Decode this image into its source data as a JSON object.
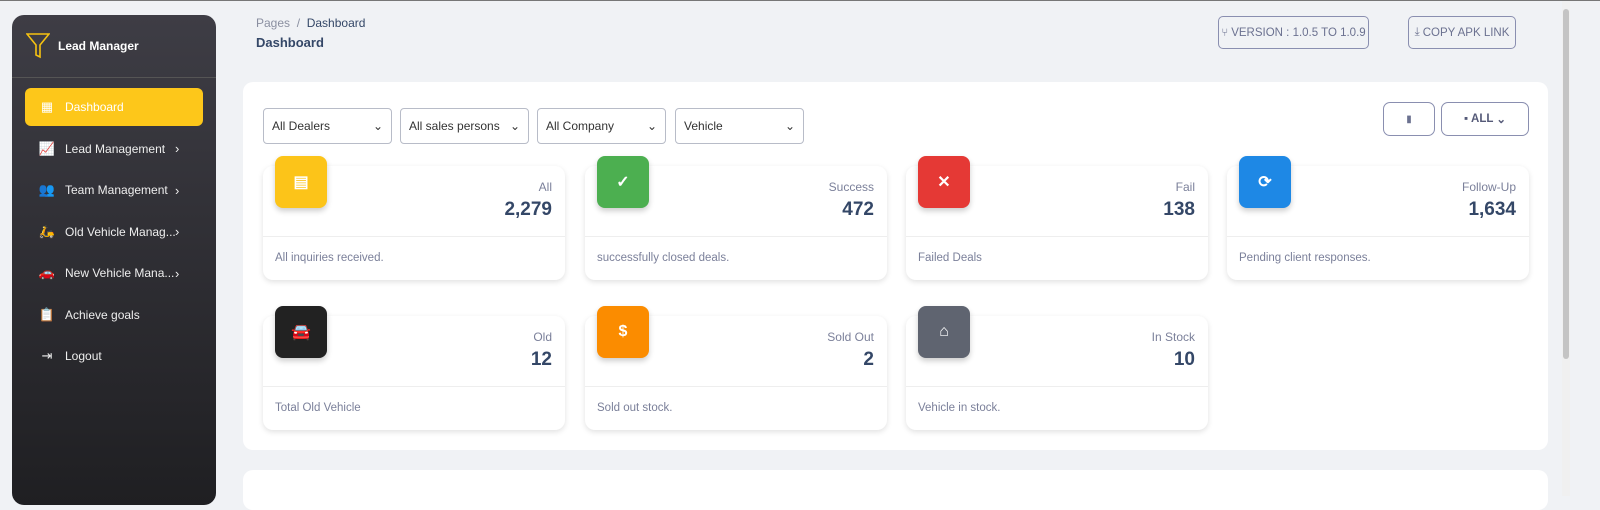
{
  "sidebar": {
    "brand": "Lead Manager",
    "items": [
      {
        "label": "Dashboard",
        "icon": "grid-icon",
        "active": true
      },
      {
        "label": "Lead Management",
        "icon": "chart-line-icon",
        "submenu": true
      },
      {
        "label": "Team Management",
        "icon": "users-icon",
        "submenu": true
      },
      {
        "label": "Old Vehicle Manag...",
        "icon": "scooter-icon",
        "submenu": true
      },
      {
        "label": "New Vehicle Mana...",
        "icon": "car-icon",
        "submenu": true
      },
      {
        "label": "Achieve goals",
        "icon": "clipboard-icon"
      },
      {
        "label": "Logout",
        "icon": "logout-icon"
      }
    ]
  },
  "header": {
    "breadcrumb_root": "Pages",
    "breadcrumb_sep": "/",
    "breadcrumb_current": "Dashboard",
    "title": "Dashboard",
    "version_label": "VERSION : 1.0.5 TO 1.0.9",
    "apk_label": "COPY APK LINK"
  },
  "filters": {
    "dealers": "All Dealers",
    "sales": "All sales persons",
    "company": "All Company",
    "vehicle": "Vehicle",
    "range": "ALL"
  },
  "stats": [
    {
      "label": "All",
      "value": "2,279",
      "desc": "All inquiries received.",
      "color": "#fcc419",
      "icon": "clipboard-icon"
    },
    {
      "label": "Success",
      "value": "472",
      "desc": "successfully closed deals.",
      "color": "#4caf50",
      "icon": "check-circle-icon"
    },
    {
      "label": "Fail",
      "value": "138",
      "desc": "Failed Deals",
      "color": "#e53935",
      "icon": "x-circle-icon"
    },
    {
      "label": "Follow-Up",
      "value": "1,634",
      "desc": "Pending client responses.",
      "color": "#1e88e5",
      "icon": "refresh-icon"
    },
    {
      "label": "Old",
      "value": "12",
      "desc": "Total Old Vehicle",
      "color": "#222222",
      "icon": "car-icon"
    },
    {
      "label": "Sold Out",
      "value": "2",
      "desc": "Sold out stock.",
      "color": "#fb8c00",
      "icon": "dollar-icon"
    },
    {
      "label": "In Stock",
      "value": "10",
      "desc": "Vehicle in stock.",
      "color": "#5f6470",
      "icon": "warehouse-icon"
    }
  ]
}
